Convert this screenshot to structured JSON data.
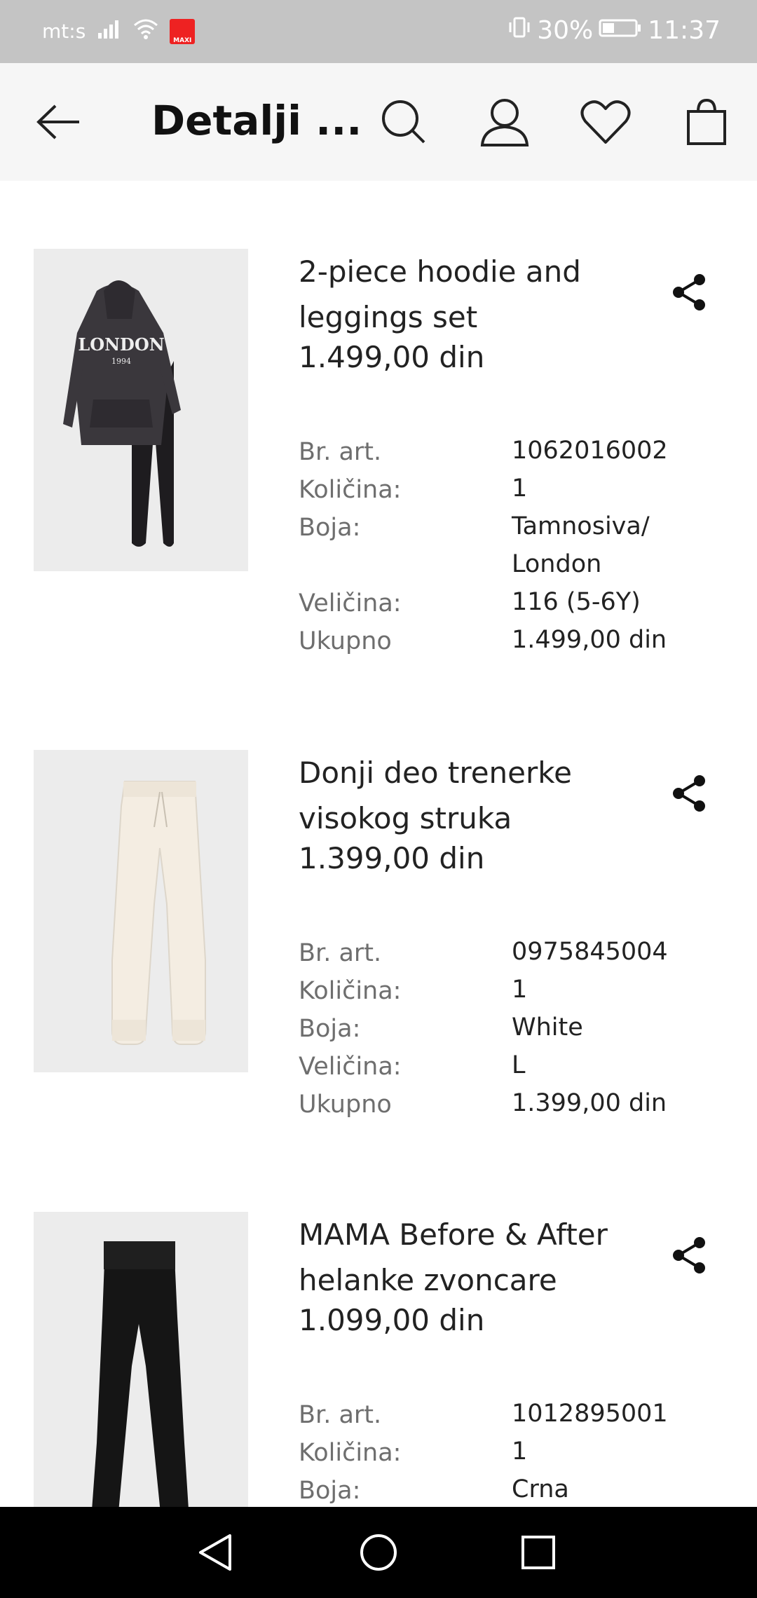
{
  "status_bar": {
    "carrier": "mt:s",
    "maxi_badge": "MAXI",
    "battery": "30%",
    "time": "11:37"
  },
  "header": {
    "title": "Detalji ..."
  },
  "products": [
    {
      "name": "2-piece hoodie and leggings set",
      "price": "1.499,00 din",
      "image_text": "LONDON",
      "image_subtext": "1994",
      "details": [
        {
          "label": "Br. art.",
          "value": "1062016002"
        },
        {
          "label": "Količina:",
          "value": "1"
        },
        {
          "label": "Boja:",
          "value": "Tamnosiva/ London"
        },
        {
          "label": "Veličina:",
          "value": "116 (5-6Y)"
        },
        {
          "label": "Ukupno",
          "value": "1.499,00 din"
        }
      ]
    },
    {
      "name": "Donji deo trenerke visokog struka",
      "price": "1.399,00 din",
      "details": [
        {
          "label": "Br. art.",
          "value": "0975845004"
        },
        {
          "label": "Količina:",
          "value": "1"
        },
        {
          "label": "Boja:",
          "value": "White"
        },
        {
          "label": "Veličina:",
          "value": "L"
        },
        {
          "label": "Ukupno",
          "value": "1.399,00 din"
        }
      ]
    },
    {
      "name": "MAMA Before & After helanke zvoncare",
      "price": "1.099,00 din",
      "details": [
        {
          "label": "Br. art.",
          "value": "1012895001"
        },
        {
          "label": "Količina:",
          "value": "1"
        },
        {
          "label": "Boja:",
          "value": "Crna"
        }
      ]
    }
  ]
}
